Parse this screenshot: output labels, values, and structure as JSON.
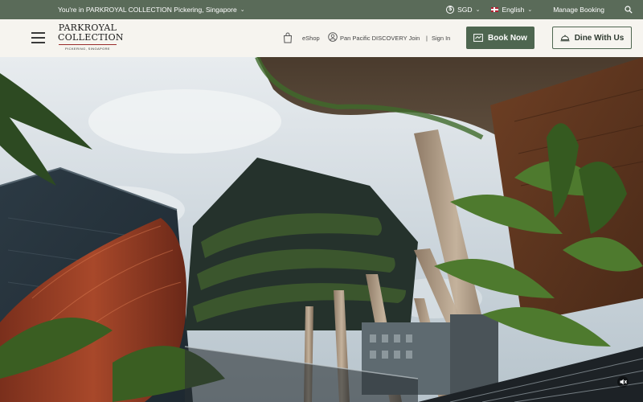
{
  "topbar": {
    "location_text": "You're in PARKROYAL COLLECTION Pickering, Singapore",
    "currency": "SGD",
    "language": "English",
    "manage_booking": "Manage Booking",
    "caret_glyph": "⌄"
  },
  "header": {
    "logo": {
      "line1": "PARKROYAL",
      "line2": "COLLECTION",
      "line3": "PICKERING, SINGAPORE"
    },
    "eshop": "eShop",
    "pp_join": "Pan Pacific DISCOVERY Join",
    "separator": "|",
    "sign_in": "Sign In",
    "book_now": "Book Now",
    "dine_with_us": "Dine With Us"
  },
  "colors": {
    "topbar_bg": "#5a6b59",
    "header_bg": "#f6f4ef",
    "accent_green": "#4e6650",
    "logo_rule": "#9a2b2b"
  },
  "icons": {
    "currency": "dollar-circle-icon",
    "language": "uk-flag-icon",
    "search": "search-icon",
    "menu": "hamburger-menu-icon",
    "eshop": "shopping-bag-icon",
    "account": "user-circle-icon",
    "book": "calendar-icon",
    "dine": "cloche-icon",
    "video": "mute-icon"
  }
}
